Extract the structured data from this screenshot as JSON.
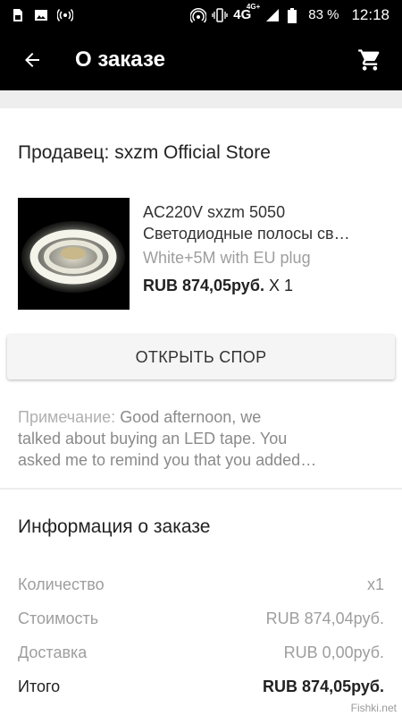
{
  "status_bar": {
    "battery": "83 %",
    "time": "12:18",
    "network": "4G",
    "network_sup": "4G+"
  },
  "app_bar": {
    "title": "О заказе"
  },
  "order": {
    "seller": "Продавец: sxzm Official Store",
    "product_title_line1": "AC220V sxzm 5050",
    "product_title_line2": "Светодиодные полосы св…",
    "variant": "White+5M with EU plug",
    "price": "RUB 874,05руб.",
    "qty": "X 1",
    "dispute_button": "ОТКРЫТЬ СПОР",
    "note_label": "Примечание:",
    "note_line1": " Good afternoon, we",
    "note_line2": "talked about buying an LED tape. You",
    "note_line3": "asked me to remind you that you added…"
  },
  "info": {
    "title": "Информация о заказе",
    "rows": [
      {
        "label": "Количество",
        "value": "x1"
      },
      {
        "label": "Стоимость",
        "value": "RUB 874,04руб."
      },
      {
        "label": "Доставка",
        "value": "RUB 0,00руб."
      },
      {
        "label": "Итого",
        "value": "RUB 874,05руб."
      }
    ]
  },
  "watermark": "Fishki.net",
  "colors": {
    "bar_background": "#000000",
    "secondary_text": "#9e9e9e",
    "page_background": "#eeeeee"
  }
}
